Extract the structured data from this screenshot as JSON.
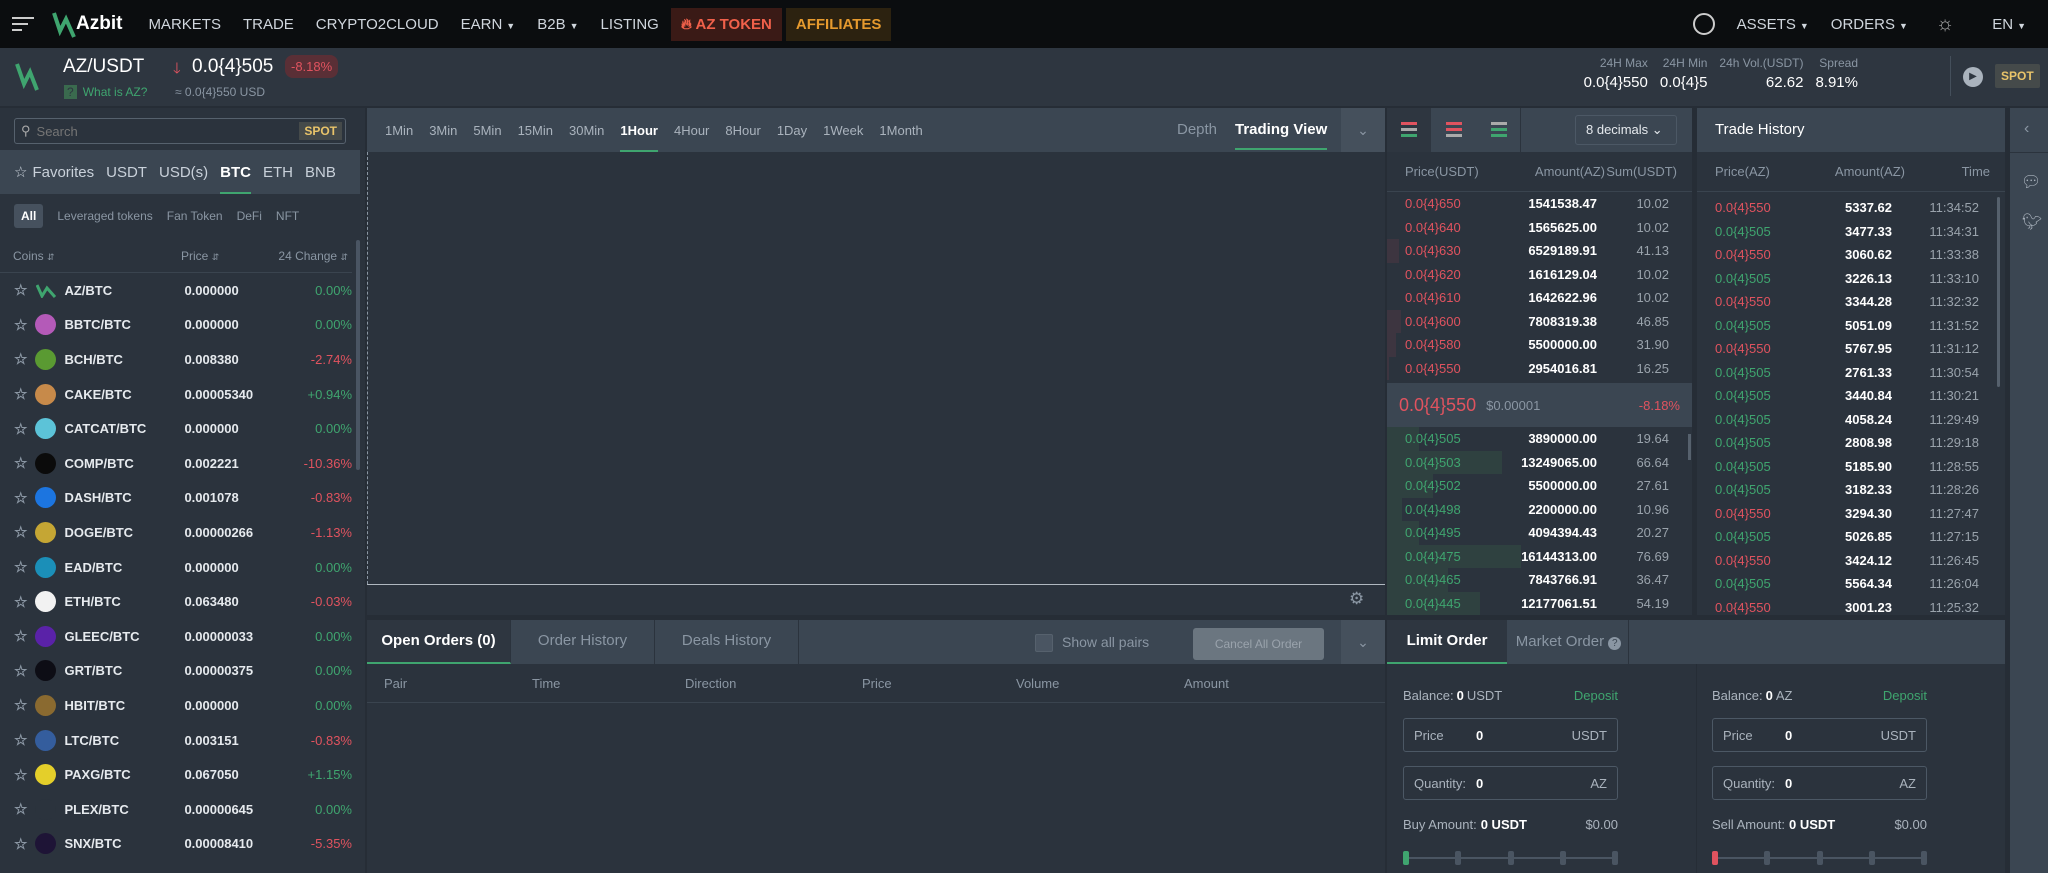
{
  "nav": {
    "logo": "Azbit",
    "items": [
      "MARKETS",
      "TRADE",
      "CRYPTO2CLOUD",
      "EARN",
      "B2B",
      "LISTING"
    ],
    "az_token": "AZ TOKEN",
    "affiliates": "AFFILIATES",
    "assets": "ASSETS",
    "orders": "ORDERS",
    "lang": "EN"
  },
  "ticker": {
    "pair": "AZ/USDT",
    "price": "0.0{4}505",
    "change": "-8.18%",
    "what_is": "What is AZ?",
    "usd": "≈ 0.0{4}550 USD",
    "stats": [
      {
        "label": "24H Max",
        "value": "0.0{4}550"
      },
      {
        "label": "24H Min",
        "value": "0.0{4}5"
      },
      {
        "label": "24h Vol.(USDT)",
        "value": "62.62"
      },
      {
        "label": "Spread",
        "value": "8.91%"
      }
    ],
    "spot": "SPOT"
  },
  "markets": {
    "search_placeholder": "Search",
    "spot": "SPOT",
    "tabs": [
      "Favorites",
      "USDT",
      "USD(s)",
      "BTC",
      "ETH",
      "BNB"
    ],
    "active_tab": "BTC",
    "subtabs": [
      "All",
      "Leveraged tokens",
      "Fan Token",
      "DeFi",
      "NFT"
    ],
    "cols": [
      "Coins",
      "Price",
      "24 Change"
    ],
    "rows": [
      {
        "pair": "AZ/BTC",
        "price": "0.000000",
        "change": "0.00%",
        "color": "#3fa56f"
      },
      {
        "pair": "BBTC/BTC",
        "price": "0.000000",
        "change": "0.00%",
        "color": "#b45ab8"
      },
      {
        "pair": "BCH/BTC",
        "price": "0.008380",
        "change": "-2.74%",
        "color": "#5a9a32"
      },
      {
        "pair": "CAKE/BTC",
        "price": "0.00005340",
        "change": "+0.94%",
        "color": "#c78a4a"
      },
      {
        "pair": "CATCAT/BTC",
        "price": "0.000000",
        "change": "0.00%",
        "color": "#5cc3d8"
      },
      {
        "pair": "COMP/BTC",
        "price": "0.002221",
        "change": "-10.36%",
        "color": "#0b0b0b"
      },
      {
        "pair": "DASH/BTC",
        "price": "0.001078",
        "change": "-0.83%",
        "color": "#1c75e0"
      },
      {
        "pair": "DOGE/BTC",
        "price": "0.00000266",
        "change": "-1.13%",
        "color": "#c5a634"
      },
      {
        "pair": "EAD/BTC",
        "price": "0.000000",
        "change": "0.00%",
        "color": "#1b8fb8"
      },
      {
        "pair": "ETH/BTC",
        "price": "0.063480",
        "change": "-0.03%",
        "color": "#f2f2f2"
      },
      {
        "pair": "GLEEC/BTC",
        "price": "0.00000033",
        "change": "0.00%",
        "color": "#5a22a8"
      },
      {
        "pair": "GRT/BTC",
        "price": "0.00000375",
        "change": "0.00%",
        "color": "#0d0d15"
      },
      {
        "pair": "HBIT/BTC",
        "price": "0.000000",
        "change": "0.00%",
        "color": "#8a6a30"
      },
      {
        "pair": "LTC/BTC",
        "price": "0.003151",
        "change": "-0.83%",
        "color": "#345d9d"
      },
      {
        "pair": "PAXG/BTC",
        "price": "0.067050",
        "change": "+1.15%",
        "color": "#e4cf2a"
      },
      {
        "pair": "PLEX/BTC",
        "price": "0.00000645",
        "change": "0.00%",
        "color": "#2b333d"
      },
      {
        "pair": "SNX/BTC",
        "price": "0.00008410",
        "change": "-5.35%",
        "color": "#1e1436"
      }
    ]
  },
  "chart": {
    "intervals": [
      "1Min",
      "3Min",
      "5Min",
      "15Min",
      "30Min",
      "1Hour",
      "4Hour",
      "8Hour",
      "1Day",
      "1Week",
      "1Month"
    ],
    "active": "1Hour",
    "depth": "Depth",
    "trading_view": "Trading View"
  },
  "orders_panel": {
    "tabs": [
      "Open Orders (0)",
      "Order History",
      "Deals History"
    ],
    "show_all": "Show all pairs",
    "cancel_all": "Cancel All Order",
    "cols": [
      "Pair",
      "Time",
      "Direction",
      "Price",
      "Volume",
      "Amount"
    ]
  },
  "orderbook": {
    "decimals": "8 decimals",
    "cols": [
      "Price(USDT)",
      "Amount(AZ)",
      "Sum(USDT)"
    ],
    "asks": [
      [
        "0.0{4}650",
        "1541538.47",
        "10.02",
        0
      ],
      [
        "0.0{4}640",
        "1565625.00",
        "10.02",
        0
      ],
      [
        "0.0{4}630",
        "6529189.91",
        "41.13",
        0.2
      ],
      [
        "0.0{4}620",
        "1616129.04",
        "10.02",
        0
      ],
      [
        "0.0{4}610",
        "1642622.96",
        "10.02",
        0
      ],
      [
        "0.0{4}600",
        "7808319.38",
        "46.85",
        0.23
      ],
      [
        "0.0{4}580",
        "5500000.00",
        "31.90",
        0.16
      ],
      [
        "0.0{4}550",
        "2954016.81",
        "16.25",
        0.03
      ]
    ],
    "mid": {
      "price": "0.0{4}550",
      "usd": "$0.00001",
      "change": "-8.18%"
    },
    "bids": [
      [
        "0.0{4}505",
        "3890000.00",
        "19.64",
        0.55
      ],
      [
        "0.0{4}503",
        "13249065.00",
        "66.64",
        1.95
      ],
      [
        "0.0{4}502",
        "5500000.00",
        "27.61",
        0.78
      ],
      [
        "0.0{4}498",
        "2200000.00",
        "10.96",
        0.25
      ],
      [
        "0.0{4}495",
        "4094394.43",
        "20.27",
        0.55
      ],
      [
        "0.0{4}475",
        "16144313.00",
        "76.69",
        2.27
      ],
      [
        "0.0{4}465",
        "7843766.91",
        "36.47",
        1.03
      ],
      [
        "0.0{4}445",
        "12177061.51",
        "54.19",
        1.58
      ]
    ]
  },
  "trades": {
    "title": "Trade History",
    "cols": [
      "Price(AZ)",
      "Amount(AZ)",
      "Time"
    ],
    "rows": [
      [
        "0.0{4}550",
        "5337.62",
        "11:34:52",
        "s"
      ],
      [
        "0.0{4}505",
        "3477.33",
        "11:34:31",
        "b"
      ],
      [
        "0.0{4}550",
        "3060.62",
        "11:33:38",
        "s"
      ],
      [
        "0.0{4}505",
        "3226.13",
        "11:33:10",
        "b"
      ],
      [
        "0.0{4}550",
        "3344.28",
        "11:32:32",
        "s"
      ],
      [
        "0.0{4}505",
        "5051.09",
        "11:31:52",
        "b"
      ],
      [
        "0.0{4}550",
        "5767.95",
        "11:31:12",
        "s"
      ],
      [
        "0.0{4}505",
        "2761.33",
        "11:30:54",
        "b"
      ],
      [
        "0.0{4}505",
        "3440.84",
        "11:30:21",
        "b"
      ],
      [
        "0.0{4}505",
        "4058.24",
        "11:29:49",
        "b"
      ],
      [
        "0.0{4}505",
        "2808.98",
        "11:29:18",
        "b"
      ],
      [
        "0.0{4}505",
        "5185.90",
        "11:28:55",
        "b"
      ],
      [
        "0.0{4}505",
        "3182.33",
        "11:28:26",
        "b"
      ],
      [
        "0.0{4}550",
        "3294.30",
        "11:27:47",
        "s"
      ],
      [
        "0.0{4}505",
        "5026.85",
        "11:27:15",
        "b"
      ],
      [
        "0.0{4}550",
        "3424.12",
        "11:26:45",
        "s"
      ],
      [
        "0.0{4}505",
        "5564.34",
        "11:26:04",
        "b"
      ],
      [
        "0.0{4}550",
        "3001.23",
        "11:25:32",
        "s"
      ]
    ]
  },
  "form": {
    "tabs": [
      "Limit Order",
      "Market Order"
    ],
    "buy": {
      "balance_label": "Balance:",
      "balance": "0",
      "balance_unit": "USDT",
      "deposit": "Deposit",
      "price_label": "Price",
      "price": "0",
      "price_unit": "USDT",
      "qty_label": "Quantity:",
      "qty": "0",
      "qty_unit": "AZ",
      "amount_label": "Buy Amount:",
      "amount": "0 USDT",
      "usd": "$0.00"
    },
    "sell": {
      "balance_label": "Balance:",
      "balance": "0",
      "balance_unit": "AZ",
      "deposit": "Deposit",
      "price_label": "Price",
      "price": "0",
      "price_unit": "USDT",
      "qty_label": "Quantity:",
      "qty": "0",
      "qty_unit": "AZ",
      "amount_label": "Sell Amount:",
      "amount": "0 USDT",
      "usd": "$0.00"
    }
  },
  "colors": {
    "green": "#3fa56f",
    "red": "#e0535f"
  }
}
